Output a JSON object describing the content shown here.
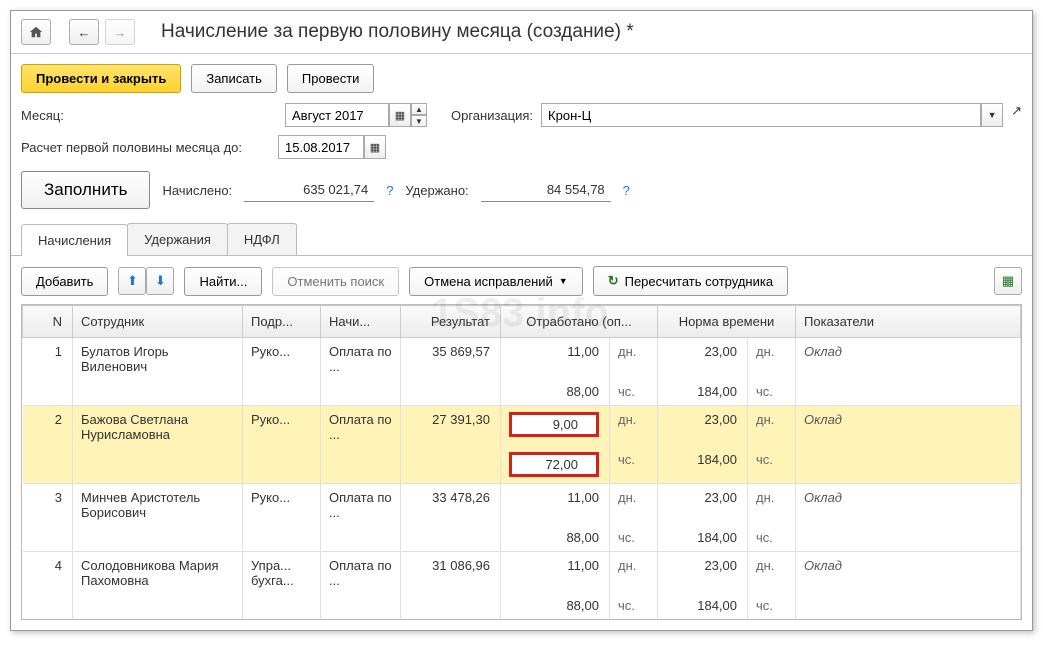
{
  "header": {
    "title": "Начисление за первую половину месяца (создание) *"
  },
  "toolbar": {
    "post_close": "Провести и закрыть",
    "save": "Записать",
    "post": "Провести"
  },
  "form": {
    "month_label": "Месяц:",
    "month_value": "Август 2017",
    "org_label": "Организация:",
    "org_value": "Крон-Ц",
    "calc_until_label": "Расчет первой половины месяца до:",
    "calc_until_value": "15.08.2017"
  },
  "summary": {
    "fill_btn": "Заполнить",
    "accrued_label": "Начислено:",
    "accrued_value": "635 021,74",
    "withheld_label": "Удержано:",
    "withheld_value": "84 554,78"
  },
  "tabs": {
    "t1": "Начисления",
    "t2": "Удержания",
    "t3": "НДФЛ"
  },
  "subtoolbar": {
    "add": "Добавить",
    "find": "Найти...",
    "cancel_search": "Отменить поиск",
    "cancel_corr": "Отмена исправлений",
    "recalc": "Пересчитать сотрудника"
  },
  "columns": {
    "n": "N",
    "employee": "Сотрудник",
    "dept": "Подр...",
    "accrual": "Начи...",
    "result": "Результат",
    "worked": "Отработано (оп...",
    "norm": "Норма времени",
    "indicators": "Показатели"
  },
  "rows": [
    {
      "n": "1",
      "employee": "Булатов Игорь Виленович",
      "dept": "Руко...",
      "accrual": "Оплата по ...",
      "result": "35 869,57",
      "worked_d": "11,00",
      "worked_h": "88,00",
      "norm_d": "23,00",
      "norm_h": "184,00",
      "indicator": "Оклад",
      "highlight": false
    },
    {
      "n": "2",
      "employee": "Бажова Светлана Нурисламовна",
      "dept": "Руко...",
      "accrual": "Оплата по ...",
      "result": "27 391,30",
      "worked_d": "9,00",
      "worked_h": "72,00",
      "norm_d": "23,00",
      "norm_h": "184,00",
      "indicator": "Оклад",
      "highlight": true
    },
    {
      "n": "3",
      "employee": "Минчев Аристотель Борисович",
      "dept": "Руко...",
      "accrual": "Оплата по ...",
      "result": "33 478,26",
      "worked_d": "11,00",
      "worked_h": "88,00",
      "norm_d": "23,00",
      "norm_h": "184,00",
      "indicator": "Оклад",
      "highlight": false
    },
    {
      "n": "4",
      "employee": "Солодовникова Мария Пахомовна",
      "dept": "Упра... бухга...",
      "accrual": "Оплата по ...",
      "result": "31 086,96",
      "worked_d": "11,00",
      "worked_h": "88,00",
      "norm_d": "23,00",
      "norm_h": "184,00",
      "indicator": "Оклад",
      "highlight": false
    }
  ],
  "units": {
    "days": "дн.",
    "hours": "чс."
  }
}
